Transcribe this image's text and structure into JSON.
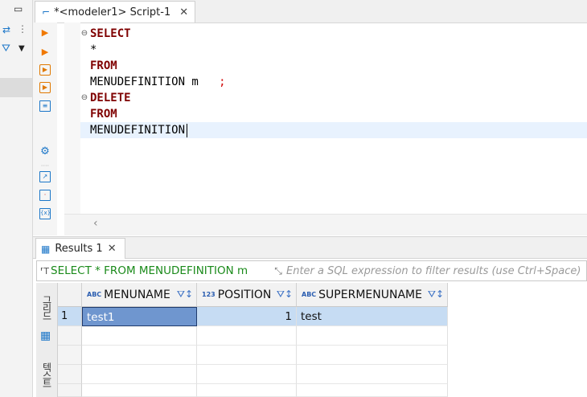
{
  "editor": {
    "tab_title": "*<modeler1> Script-1",
    "lines": [
      "SELECT",
      "*",
      "FROM",
      "MENUDEFINITION m",
      ";",
      "DELETE",
      "FROM",
      "MENUDEFINITION"
    ]
  },
  "results": {
    "tab_title": "Results 1",
    "filter_query": "SELECT * FROM MENUDEFINITION m",
    "filter_placeholder": "Enter a SQL expression to filter results (use Ctrl+Space)",
    "side_tabs": [
      "그리드",
      "텍스트"
    ],
    "columns": [
      {
        "type": "ABC",
        "name": "MENUNAME"
      },
      {
        "type": "123",
        "name": "POSITION"
      },
      {
        "type": "ABC",
        "name": "SUPERMENUNAME"
      }
    ],
    "rows": [
      {
        "num": "1",
        "cells": [
          "test1",
          "1",
          "test"
        ]
      }
    ]
  }
}
